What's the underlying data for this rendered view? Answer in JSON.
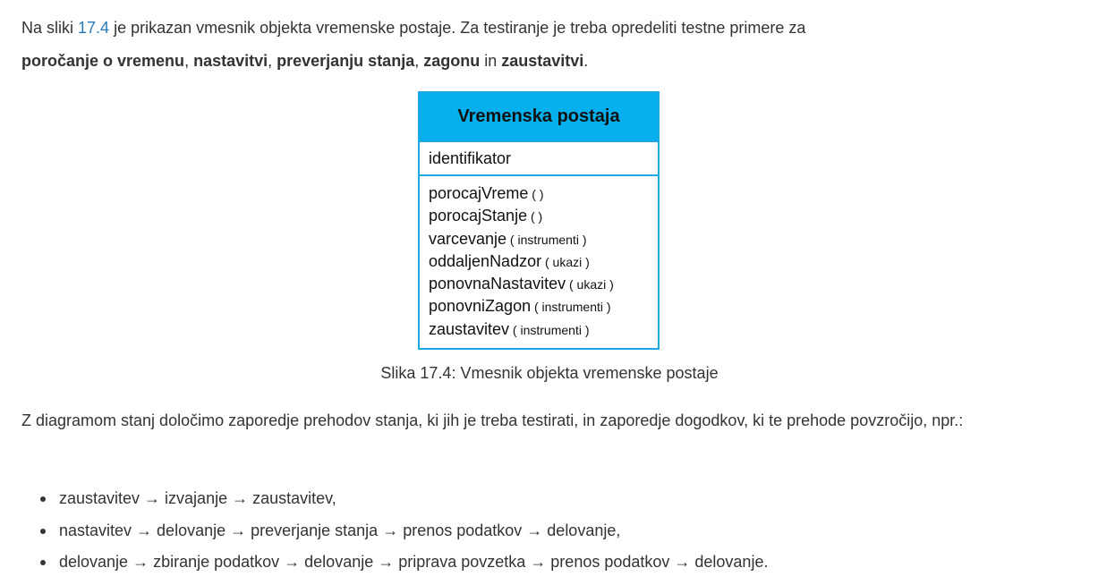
{
  "intro": {
    "prefix": "Na sliki ",
    "figure_ref": "17.4",
    "middle": " je prikazan vmesnik objekta vremenske postaje. Za testiranje je treba opredeliti testne primere za",
    "t1": "poročanje o vremenu",
    "sep1": ", ",
    "t2": "nastavitvi",
    "sep2": ", ",
    "t3": "preverjanju stanja",
    "sep3": ", ",
    "t4": "zagonu",
    "sep4": " in ",
    "t5": "zaustavitvi",
    "end": "."
  },
  "uml": {
    "class_name": "Vremenska postaja",
    "attribute": "identifikator",
    "operations": [
      {
        "name": "porocajVreme",
        "args": " ( )"
      },
      {
        "name": "porocajStanje",
        "args": " ( )"
      },
      {
        "name": "varcevanje",
        "args": " ( instrumenti )"
      },
      {
        "name": "oddaljenNadzor",
        "args": " ( ukazi )"
      },
      {
        "name": "ponovnaNastavitev",
        "args": " ( ukazi )"
      },
      {
        "name": "ponovniZagon",
        "args": " ( instrumenti )"
      },
      {
        "name": "zaustavitev",
        "args": " ( instrumenti )"
      }
    ]
  },
  "caption": "Slika 17.4: Vmesnik objekta vremenske postaje",
  "paragraph2": "Z diagramom stanj določimo zaporedje prehodov stanja, ki jih je treba testirati, in zaporedje dogodkov, ki te prehode povzročijo, npr.:",
  "sequences": [
    "zaustavitev → izvajanje → zaustavitev,",
    "nastavitev → delovanje → preverjanje stanja → prenos podatkov → delovanje,",
    "delovanje → zbiranje podatkov → delovanje → priprava povzetka → prenos podatkov → delovanje."
  ]
}
